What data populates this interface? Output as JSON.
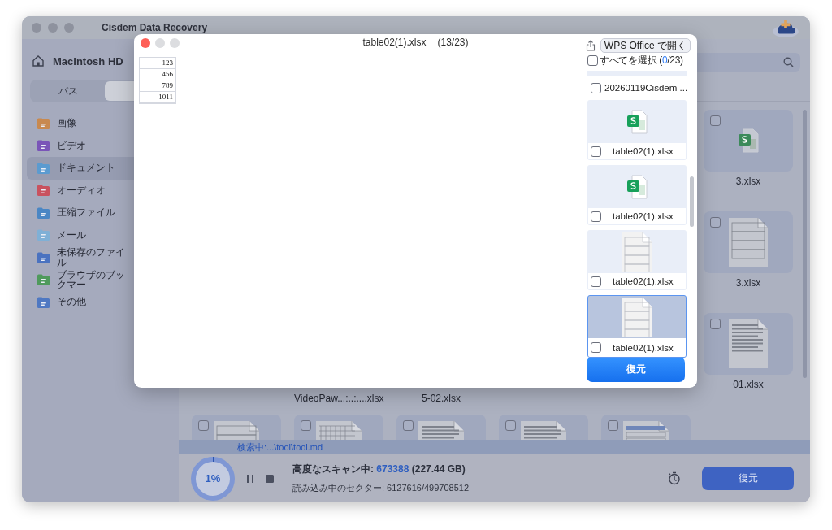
{
  "app": {
    "title": "Cisdem Data Recovery"
  },
  "sidebar": {
    "drive": "Macintosh HD",
    "tabs": [
      {
        "label": "パス",
        "selected": false
      },
      {
        "selected": true
      }
    ],
    "items": [
      {
        "label": "画像",
        "color": "#c8894f",
        "selected": false
      },
      {
        "label": "ビデオ",
        "color": "#7a55b8",
        "selected": false
      },
      {
        "label": "ドキュメント",
        "color": "#5b9bd0",
        "selected": true
      },
      {
        "label": "オーディオ",
        "color": "#c9525f",
        "selected": false
      },
      {
        "label": "圧縮ファイル",
        "color": "#4a86c4",
        "selected": false
      },
      {
        "label": "メール",
        "color": "#7fb0d6",
        "selected": false
      },
      {
        "label": "未保存のファイル",
        "color": "#4a72c0",
        "selected": false
      },
      {
        "label": "ブラウザのブックマー",
        "color": "#4f9a5c",
        "selected": false
      },
      {
        "label": "その他",
        "color": "#4f78c2",
        "selected": false
      }
    ]
  },
  "files": {
    "right_column": [
      {
        "name": "3.xlsx",
        "kind": "sheet",
        "checked": false
      },
      {
        "name": "3.xlsx",
        "kind": "table",
        "checked": false
      },
      {
        "name": "01.xlsx",
        "kind": "text",
        "checked": false
      }
    ],
    "lower_labels": [
      "VideoPaw...:..:....xlsx",
      "5-02.xlsx"
    ],
    "bottom_row": [
      {
        "kind": "table",
        "checked": false
      },
      {
        "kind": "grid",
        "checked": false
      },
      {
        "kind": "text",
        "checked": false
      },
      {
        "kind": "text",
        "checked": false
      },
      {
        "kind": "form",
        "checked": false
      }
    ]
  },
  "status": {
    "path": "検索中:...\\tool\\tool.md"
  },
  "scan": {
    "percent": "1%",
    "level": 0.01,
    "label": "高度なスキャン中: ",
    "count": "673388",
    "size": " (227.44 GB)",
    "sectors": "読み込み中のセクター: 6127616/499708512"
  },
  "restore_button": "復元",
  "preview_dialog": {
    "title": "table02(1).xlsx",
    "position": "(13/23)",
    "open_button": "WPS Office で開く",
    "preview_cells": [
      "123",
      "456",
      "789",
      "1011"
    ],
    "select_all": {
      "label": "すべてを選択 (",
      "count": "0",
      "suffix": "/23)",
      "checked": false
    },
    "files": [
      {
        "name": "20260119Cisdem ...",
        "kind": "cut",
        "checked": false,
        "selected": false
      },
      {
        "name": "table02(1).xlsx",
        "kind": "sheet",
        "checked": false,
        "selected": false
      },
      {
        "name": "table02(1).xlsx",
        "kind": "sheet",
        "checked": false,
        "selected": false
      },
      {
        "name": "table02(1).xlsx",
        "kind": "table",
        "checked": false,
        "selected": false
      },
      {
        "name": "table02(1).xlsx",
        "kind": "table",
        "checked": false,
        "selected": true
      }
    ],
    "restore_button": "復元"
  }
}
